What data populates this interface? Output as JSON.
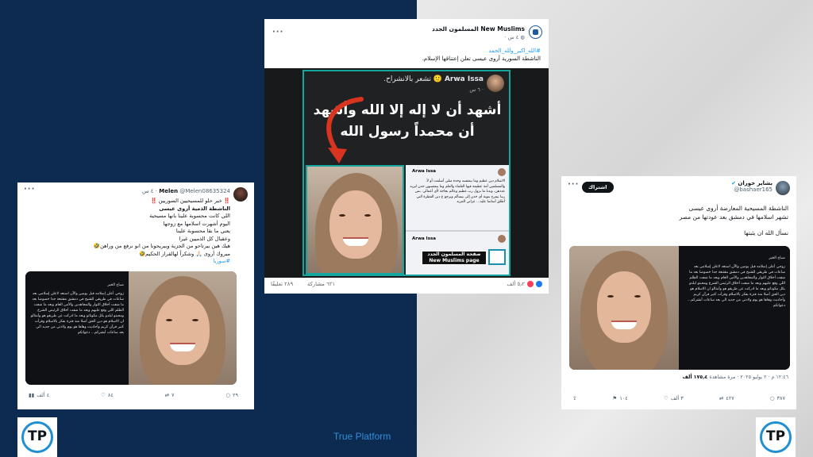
{
  "brand": {
    "footer_text": "True Platform",
    "logo_letters": "TP"
  },
  "left_post": {
    "author_name": "Melen",
    "handle_time": "@Melen08635324 · ٤ س",
    "line1": "‼️ خبر حلو للمسيحيين السوريين ‼️",
    "line2": "الناشطة الذمية أروى عيسى",
    "line3": "اللي كانت محسوبة علينا بانها مسيحية",
    "line4": "اليوم أشهرت اسلامها مع زوجها",
    "line5": "يعني ما نقا محسوبة علينا",
    "line6": "وعقبال كل الذميين غيرا",
    "line7": "هيك هين بيرتاحو من الجزية وبيريحونا من انو نرفع من وراهن🤣",
    "line8": "مبروك أروى 🙏🏻 وشكراً لهالقرار الحكيم🤣",
    "hashtag": "#سوريا",
    "photo_text_title": "صباح الخير",
    "photo_text_body": "زوجي أعلن إسلامه قبل يومين والآن استعد لاعلن إسلامي بعد ساعات في طريقي للشيخ في دمشق مقتنعة جدا خصوصا بعد ما شفت أخلاق الثوار والمجاهدين والأمن العام وبعد ما شفت الظلم اللي وقع عليهم وبعد ما شفت أخلاق الرئيس الشرع ومحبتو لبلدو بكل مكوناتو وبعد ما ادركت عن طريقو هو وأمثالو ان الاسلام هو دين الحق أصلا منذ فترة بفكر بالاسلام وقرأت كتير قرآن كريم وأحاديث وهاها هو يوم ولادتي من جديد الي بعد ساعات أبشركم... دعواتكم",
    "actions": {
      "replies": "٢٩",
      "reposts": "٧",
      "likes": "٨٤",
      "views": "٤ ألف"
    }
  },
  "center_post": {
    "page_name": "New Muslims المسلمون الجدد",
    "time": "٤ س ·",
    "hashtag": "#الله_اكبر_ولله_الحمد",
    "caption": "الناشطة السورية أروى عيسى تعلن إعتناقها الإسلام.",
    "inner_name": "Arwa Issa",
    "inner_feeling": "تشعر بالانشراح.",
    "inner_time": "٦ س ·",
    "shahada": "أشهد أن لا إله إلا الله وأشهد أن محمداً رسول الله",
    "mini_name": "Arwa Issa",
    "mini_text": "الاسلام دين عظيم وما يبعقسه وحدة متلي أسلمت أو لأ. والمسلمين أمة عظيمة فيها العلماء والعلم وما يبعقسهن حدن ليزيد عددهن، وبدنا ما نزول رب عظيم وعالم بحاجة لأي أعمالي. بس ربنا بيفرح بتوبة أي حدن إلى بيسألم ويرجع ع دين الفطرة التي أطلق أساسا عليه... عزاني المزيد",
    "watermark_ar": "صفحة المسلمون الجدد",
    "watermark_en": "New Muslims page",
    "reactions_count": "٥٫٢ ألف",
    "comments_count": "٢٨٩ تعليقًا",
    "shares_count": "٦٢١ مشاركة"
  },
  "right_post": {
    "author_name": "بشاير حوران",
    "handle": "@bashaer165",
    "subscribe_label": "اشتراك",
    "line1": "الناشطة المسيحية المعارضة أروى عيسى",
    "line2": "تشهر اسلامها في دمشق بعد عودتها من مصر",
    "line3": "نسأل الله ان يثبتها",
    "photo_text_title": "صباح الخير",
    "photo_text_body": "زوجي أعلن إسلامه قبل يومين والآن استعد لاعلن إسلامي بعد ساعات في طريقي للشيخ في دمشق مقتنعة جدا خصوصا بعد ما شفت أخلاق الثوار والمجاهدين والأمن العام وبعد ما شفت الظلم اللي وقع عليهم وبعد ما شفت أخلاق الرئيس الشرع ومحبتو لبلدو بكل مكوناتو وبعد ما ادركت عن طريقو هو وأمثالو ان الاسلام هو دين الحق أصلا منذ فترة بفكر بالاسلام وقرأت كتير قرآن كريم وأحاديث وهاها هو يوم ولادتي من جديد الي بعد ساعات أبشركم... دعواتكم",
    "meta": "١٢:٤٦ م · ٢ يوليو ٢٠٢٥ · مرة مشاهدة",
    "views": "١٧٥٫٤ ألف",
    "actions": {
      "replies": "٣٨٧",
      "reposts": "٤٢٧",
      "likes": "٣ ألف",
      "bookmarks": "١٠٤"
    }
  }
}
